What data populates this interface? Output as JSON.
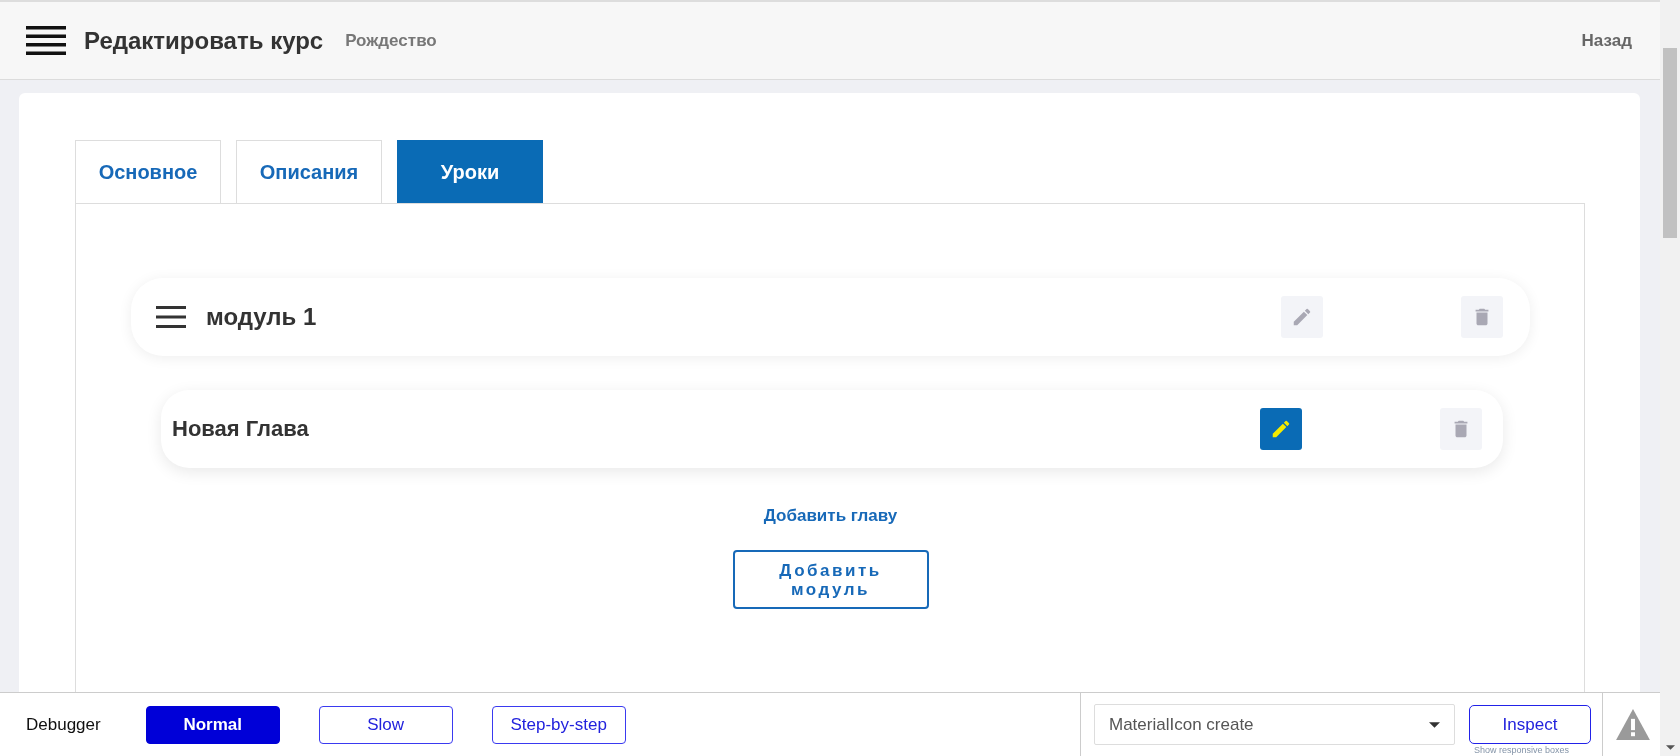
{
  "header": {
    "title": "Редактировать курс",
    "subtitle": "Рождество",
    "back": "Назад"
  },
  "tabs": [
    {
      "label": "Основное",
      "selected": false
    },
    {
      "label": "Описания",
      "selected": false
    },
    {
      "label": "Уроки",
      "selected": true
    }
  ],
  "modules": [
    {
      "title": "модуль 1",
      "edit_active": false,
      "chapters": [
        {
          "title": "Новая Глава",
          "edit_active": true
        }
      ]
    }
  ],
  "add_chapter": "Добавить главу",
  "add_module": "Добавить модуль",
  "debugger": {
    "label": "Debugger",
    "modes": [
      {
        "label": "Normal",
        "selected": true
      },
      {
        "label": "Slow",
        "selected": false
      },
      {
        "label": "Step-by-step",
        "selected": false
      }
    ],
    "select": {
      "value": "MaterialIcon create"
    },
    "inspect": "Inspect",
    "hint": "Show responsive boxes"
  }
}
